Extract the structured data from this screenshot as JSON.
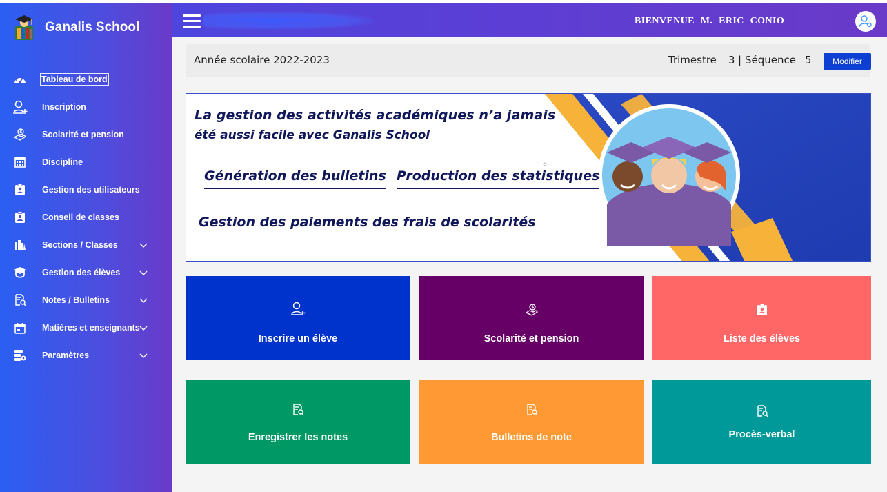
{
  "brand": {
    "name": "Ganalis School"
  },
  "sidebar": {
    "items": [
      {
        "label": "Tableau de bord",
        "icon": "dashboard-gauge-icon",
        "active": true,
        "has_submenu": false
      },
      {
        "label": "Inscription",
        "icon": "user-plus-icon",
        "has_submenu": false
      },
      {
        "label": "Scolarité et pension",
        "icon": "hand-coin-icon",
        "has_submenu": false
      },
      {
        "label": "Discipline",
        "icon": "calculator-grid-icon",
        "has_submenu": false
      },
      {
        "label": "Gestion des utilisateurs",
        "icon": "id-badge-icon",
        "has_submenu": false
      },
      {
        "label": "Conseil de classes",
        "icon": "id-badge-icon",
        "has_submenu": false
      },
      {
        "label": "Sections / Classes",
        "icon": "school-building-icon",
        "has_submenu": true
      },
      {
        "label": "Gestion des élèves",
        "icon": "graduation-cap-icon",
        "has_submenu": true
      },
      {
        "label": "Notes / Bulletins",
        "icon": "document-search-icon",
        "has_submenu": true
      },
      {
        "label": "Matières et enseignants",
        "icon": "calendar-icon",
        "has_submenu": true
      },
      {
        "label": "Paramètres",
        "icon": "server-settings-icon",
        "has_submenu": true
      }
    ]
  },
  "header": {
    "welcome": "BIENVENUE  M.  ERIC CONIO",
    "user_icon": "user-settings-icon"
  },
  "yearbar": {
    "year": "Année scolaire 2022-2023",
    "trimester_label": "Trimestre",
    "trimester_value": "3",
    "separator": "|",
    "sequence_label": "Séquence",
    "sequence_value": "5",
    "modify_label": "Modifier"
  },
  "banner": {
    "headline_1": "La gestion des activités académiques n’a jamais",
    "headline_2": "été aussi facile avec Ganalis School",
    "feature_1": "Génération des bulletins",
    "feature_2": "Production des statistiques",
    "feature_3": "Gestion des paiements des frais de scolarités"
  },
  "cards": [
    {
      "label": "Inscrire un élève",
      "icon": "user-plus-icon",
      "color": "#0033cc"
    },
    {
      "label": "Scolarité et pension",
      "icon": "hand-coin-icon",
      "color": "#660066"
    },
    {
      "label": "Liste des élèves",
      "icon": "id-badge-icon",
      "color": "#ff6666"
    },
    {
      "label": "Enregistrer les notes",
      "icon": "document-search-icon",
      "color": "#009966"
    },
    {
      "label": "Bulletins de note",
      "icon": "document-search-icon",
      "color": "#ff9933"
    },
    {
      "label": "Procès-verbal",
      "icon": "document-search-icon",
      "color": "#009999"
    }
  ]
}
